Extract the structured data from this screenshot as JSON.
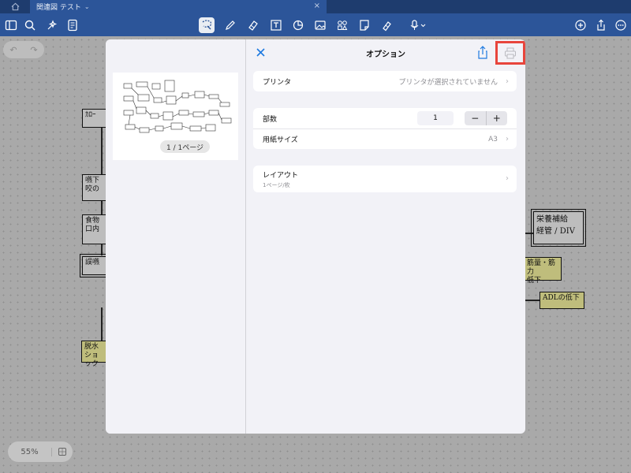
{
  "tabbar": {
    "home_icon": "home-icon",
    "tab_title": "関連図 テスト",
    "tab_chevron": "⌄",
    "tab_close": "×"
  },
  "toolbar": {
    "left_icons": [
      "sidebar-icon",
      "search-icon",
      "sparkle-icon",
      "document-icon"
    ],
    "center_icons": [
      "lasso-icon",
      "pen-icon",
      "eraser-icon",
      "text-box-icon",
      "shape-icon",
      "image-icon",
      "elements-icon",
      "sticky-note-icon",
      "highlighter-icon",
      "microphone-icon"
    ],
    "right_icons": [
      "add-icon",
      "share-icon",
      "more-icon"
    ],
    "accent_color": "#2c5599"
  },
  "canvas": {
    "undo_label": "↶",
    "redo_label": "↷",
    "zoom_level": "55%",
    "nodes": [
      "ｶﾛｰ",
      "嚥下",
      "咬の",
      "食物",
      "口内",
      "誤嚥",
      "栄養補給",
      "経管 / DIV",
      "筋量・筋力",
      "低下",
      "ADLの低下",
      "脱水",
      "ショック"
    ]
  },
  "print_dialog": {
    "title": "オプション",
    "close_label": "×",
    "page_counter": "1 / 1ページ",
    "highlight_color": "#e8453c",
    "link_color": "#1f7ae0",
    "printer": {
      "label": "プリンタ",
      "value": "プリンタが選択されていません"
    },
    "copies": {
      "label": "部数",
      "value": "1",
      "decrement": "−",
      "increment": "+"
    },
    "paper_size": {
      "label": "用紙サイズ",
      "value": "A3"
    },
    "layout": {
      "label": "レイアウト",
      "subtitle": "1ページ/枚"
    },
    "chevron": "›"
  }
}
